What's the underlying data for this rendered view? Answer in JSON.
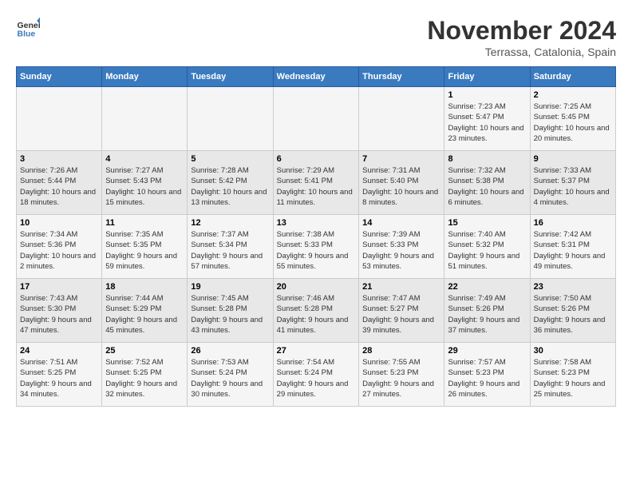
{
  "logo": {
    "line1": "General",
    "line2": "Blue"
  },
  "title": "November 2024",
  "location": "Terrassa, Catalonia, Spain",
  "weekdays": [
    "Sunday",
    "Monday",
    "Tuesday",
    "Wednesday",
    "Thursday",
    "Friday",
    "Saturday"
  ],
  "weeks": [
    [
      {
        "day": "",
        "content": ""
      },
      {
        "day": "",
        "content": ""
      },
      {
        "day": "",
        "content": ""
      },
      {
        "day": "",
        "content": ""
      },
      {
        "day": "",
        "content": ""
      },
      {
        "day": "1",
        "content": "Sunrise: 7:23 AM\nSunset: 5:47 PM\nDaylight: 10 hours and 23 minutes."
      },
      {
        "day": "2",
        "content": "Sunrise: 7:25 AM\nSunset: 5:45 PM\nDaylight: 10 hours and 20 minutes."
      }
    ],
    [
      {
        "day": "3",
        "content": "Sunrise: 7:26 AM\nSunset: 5:44 PM\nDaylight: 10 hours and 18 minutes."
      },
      {
        "day": "4",
        "content": "Sunrise: 7:27 AM\nSunset: 5:43 PM\nDaylight: 10 hours and 15 minutes."
      },
      {
        "day": "5",
        "content": "Sunrise: 7:28 AM\nSunset: 5:42 PM\nDaylight: 10 hours and 13 minutes."
      },
      {
        "day": "6",
        "content": "Sunrise: 7:29 AM\nSunset: 5:41 PM\nDaylight: 10 hours and 11 minutes."
      },
      {
        "day": "7",
        "content": "Sunrise: 7:31 AM\nSunset: 5:40 PM\nDaylight: 10 hours and 8 minutes."
      },
      {
        "day": "8",
        "content": "Sunrise: 7:32 AM\nSunset: 5:38 PM\nDaylight: 10 hours and 6 minutes."
      },
      {
        "day": "9",
        "content": "Sunrise: 7:33 AM\nSunset: 5:37 PM\nDaylight: 10 hours and 4 minutes."
      }
    ],
    [
      {
        "day": "10",
        "content": "Sunrise: 7:34 AM\nSunset: 5:36 PM\nDaylight: 10 hours and 2 minutes."
      },
      {
        "day": "11",
        "content": "Sunrise: 7:35 AM\nSunset: 5:35 PM\nDaylight: 9 hours and 59 minutes."
      },
      {
        "day": "12",
        "content": "Sunrise: 7:37 AM\nSunset: 5:34 PM\nDaylight: 9 hours and 57 minutes."
      },
      {
        "day": "13",
        "content": "Sunrise: 7:38 AM\nSunset: 5:33 PM\nDaylight: 9 hours and 55 minutes."
      },
      {
        "day": "14",
        "content": "Sunrise: 7:39 AM\nSunset: 5:33 PM\nDaylight: 9 hours and 53 minutes."
      },
      {
        "day": "15",
        "content": "Sunrise: 7:40 AM\nSunset: 5:32 PM\nDaylight: 9 hours and 51 minutes."
      },
      {
        "day": "16",
        "content": "Sunrise: 7:42 AM\nSunset: 5:31 PM\nDaylight: 9 hours and 49 minutes."
      }
    ],
    [
      {
        "day": "17",
        "content": "Sunrise: 7:43 AM\nSunset: 5:30 PM\nDaylight: 9 hours and 47 minutes."
      },
      {
        "day": "18",
        "content": "Sunrise: 7:44 AM\nSunset: 5:29 PM\nDaylight: 9 hours and 45 minutes."
      },
      {
        "day": "19",
        "content": "Sunrise: 7:45 AM\nSunset: 5:28 PM\nDaylight: 9 hours and 43 minutes."
      },
      {
        "day": "20",
        "content": "Sunrise: 7:46 AM\nSunset: 5:28 PM\nDaylight: 9 hours and 41 minutes."
      },
      {
        "day": "21",
        "content": "Sunrise: 7:47 AM\nSunset: 5:27 PM\nDaylight: 9 hours and 39 minutes."
      },
      {
        "day": "22",
        "content": "Sunrise: 7:49 AM\nSunset: 5:26 PM\nDaylight: 9 hours and 37 minutes."
      },
      {
        "day": "23",
        "content": "Sunrise: 7:50 AM\nSunset: 5:26 PM\nDaylight: 9 hours and 36 minutes."
      }
    ],
    [
      {
        "day": "24",
        "content": "Sunrise: 7:51 AM\nSunset: 5:25 PM\nDaylight: 9 hours and 34 minutes."
      },
      {
        "day": "25",
        "content": "Sunrise: 7:52 AM\nSunset: 5:25 PM\nDaylight: 9 hours and 32 minutes."
      },
      {
        "day": "26",
        "content": "Sunrise: 7:53 AM\nSunset: 5:24 PM\nDaylight: 9 hours and 30 minutes."
      },
      {
        "day": "27",
        "content": "Sunrise: 7:54 AM\nSunset: 5:24 PM\nDaylight: 9 hours and 29 minutes."
      },
      {
        "day": "28",
        "content": "Sunrise: 7:55 AM\nSunset: 5:23 PM\nDaylight: 9 hours and 27 minutes."
      },
      {
        "day": "29",
        "content": "Sunrise: 7:57 AM\nSunset: 5:23 PM\nDaylight: 9 hours and 26 minutes."
      },
      {
        "day": "30",
        "content": "Sunrise: 7:58 AM\nSunset: 5:23 PM\nDaylight: 9 hours and 25 minutes."
      }
    ]
  ]
}
